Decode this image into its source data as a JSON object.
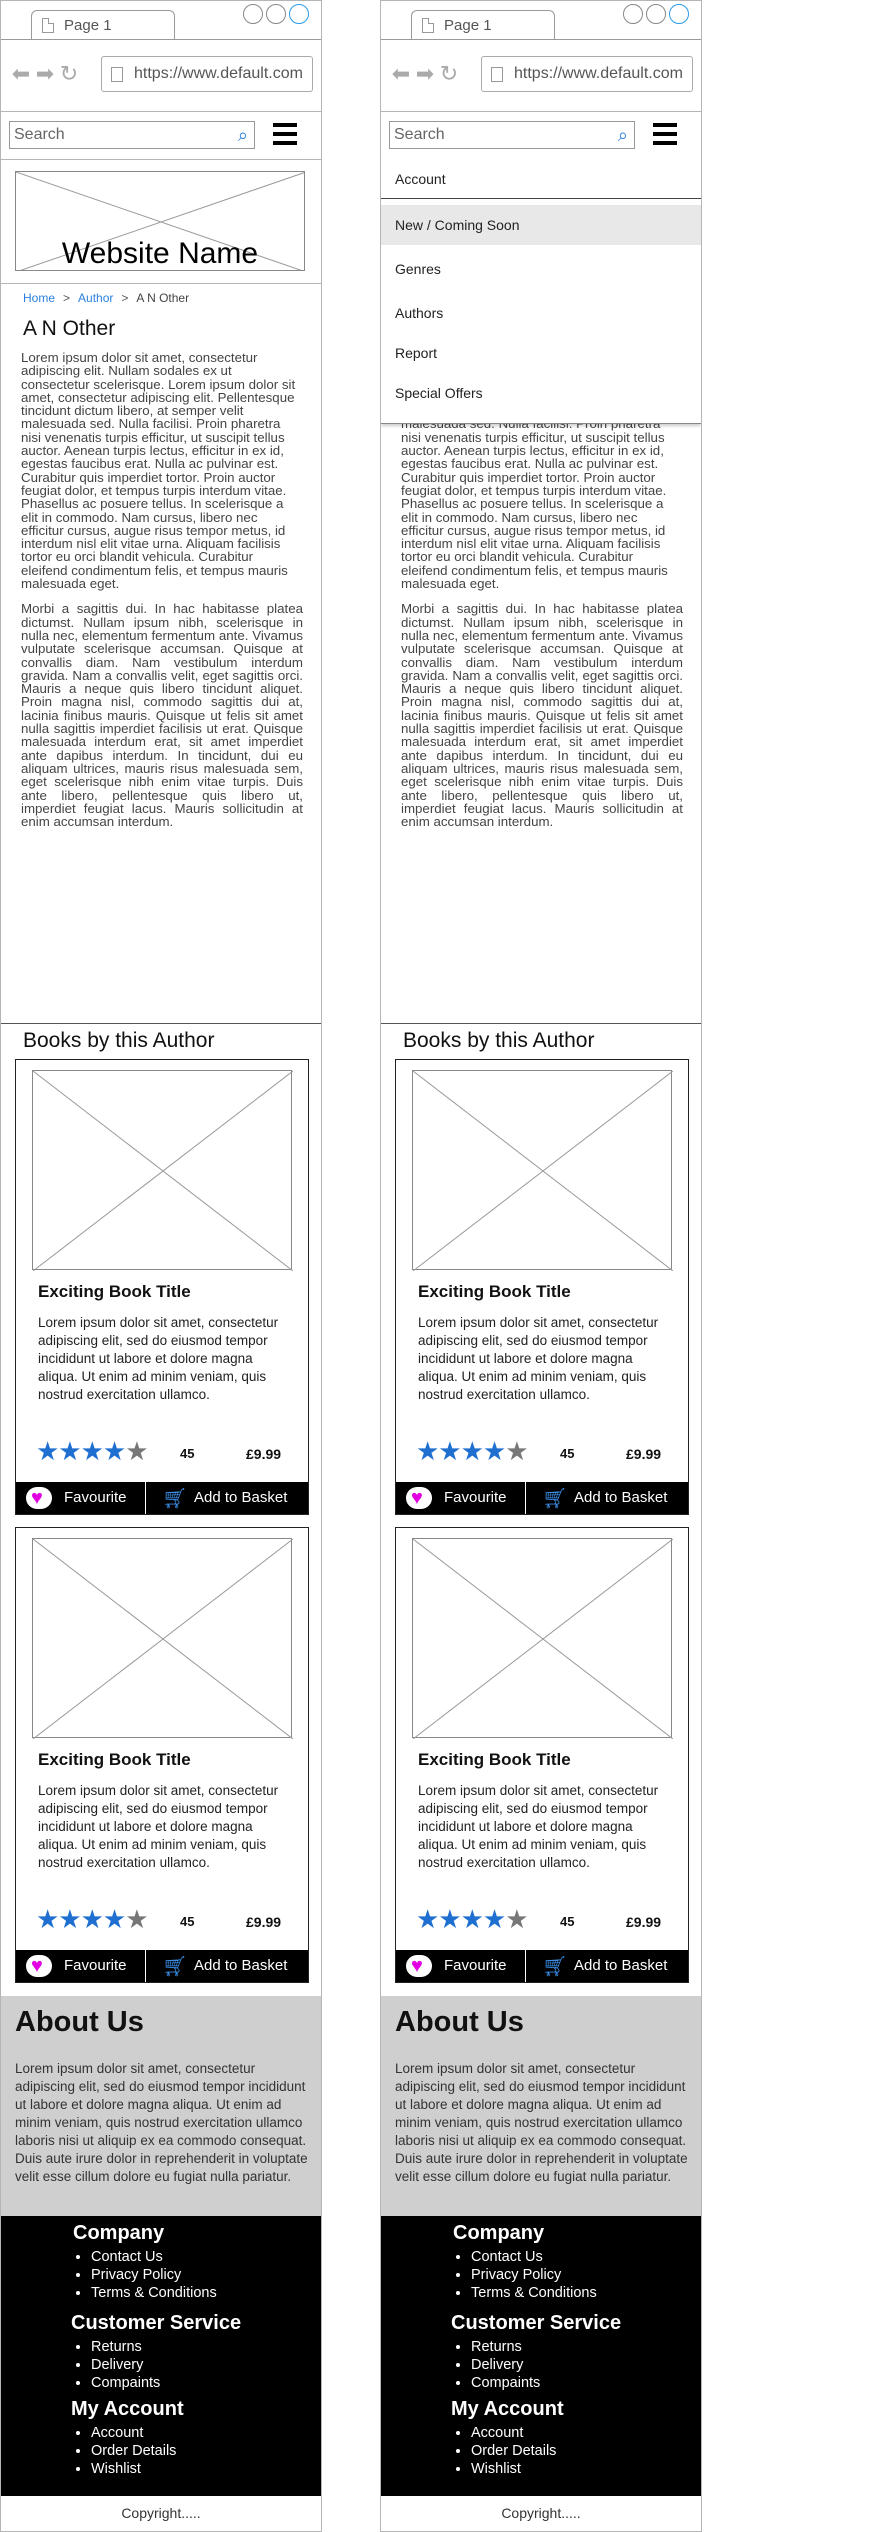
{
  "browser": {
    "tab_label": "Page 1",
    "url": "https://www.default.com"
  },
  "search": {
    "placeholder": "Search"
  },
  "site": {
    "name": "Website Name"
  },
  "breadcrumb": {
    "home": "Home",
    "author": "Author",
    "current": "A N Other",
    "separator": ">"
  },
  "author": {
    "name": "A N Other",
    "bio_p1": "Lorem ipsum dolor sit amet, consectetur adipiscing elit. Nullam sodales ex ut consectetur scelerisque. Lorem ipsum dolor sit amet, consectetur adipiscing elit. Pellentesque tincidunt dictum libero, at semper velit malesuada sed. Nulla facilisi. Proin pharetra nisi venenatis turpis efficitur, ut suscipit tellus auctor. Aenean turpis lectus, efficitur in ex id, egestas faucibus erat. Nulla ac pulvinar est. Curabitur quis imperdiet tortor. Proin auctor feugiat dolor, et tempus turpis interdum vitae. Phasellus ac posuere tellus. In scelerisque a elit in commodo. Nam cursus, libero nec efficitur cursus, augue risus tempor metus, id interdum nisl elit vitae urna. Aliquam facilisis tortor eu orci blandit vehicula. Curabitur eleifend condimentum felis, et tempus mauris malesuada eget.",
    "bio_p2": "Morbi a sagittis dui. In hac habitasse platea dictumst. Nullam ipsum nibh, scelerisque in nulla nec, elementum fermentum ante. Vivamus vulputate scelerisque accumsan. Quisque at convallis diam. Nam vestibulum interdum gravida. Nam a convallis velit, eget sagittis orci. Mauris a neque quis libero tincidunt aliquet. Proin magna nisl, commodo sagittis dui at, lacinia finibus mauris. Quisque ut felis sit amet nulla sagittis imperdiet facilisis ut erat. Quisque malesuada interdum erat, sit amet imperdiet ante dapibus interdum. In tincidunt, dui eu aliquam ultrices, mauris risus malesuada sem, eget scelerisque nibh enim vitae turpis. Duis ante libero, pellentesque quis libero ut, imperdiet feugiat lacus. Mauris sollicitudin at enim accumsan interdum."
  },
  "books_heading": "Books by this Author",
  "books": [
    {
      "title": "Exciting Book Title",
      "description": "Lorem ipsum dolor sit amet, consectetur adipiscing elit, sed do eiusmod tempor incididunt ut labore et dolore magna aliqua. Ut enim ad minim veniam, quis nostrud exercitation ullamco.",
      "rating": 4.5,
      "stars_full": "★★★★",
      "stars_half": "★",
      "rating_count": "45",
      "price": "£9.99",
      "favourite_label": "Favourite",
      "basket_label": "Add to Basket"
    },
    {
      "title": "Exciting Book Title",
      "description": "Lorem ipsum dolor sit amet, consectetur adipiscing elit, sed do eiusmod tempor incididunt ut labore et dolore magna aliqua. Ut enim ad minim veniam, quis nostrud exercitation ullamco.",
      "rating": 4.5,
      "stars_full": "★★★★",
      "stars_half": "★",
      "rating_count": "45",
      "price": "£9.99",
      "favourite_label": "Favourite",
      "basket_label": "Add to Basket"
    }
  ],
  "about": {
    "heading": "About Us",
    "text": "Lorem ipsum dolor sit amet, consectetur adipiscing elit, sed do eiusmod tempor incididunt ut labore et dolore magna aliqua. Ut enim ad minim veniam, quis nostrud exercitation ullamco laboris nisi ut aliquip ex ea commodo consequat. Duis aute irure dolor in reprehenderit in voluptate velit esse cillum dolore eu fugiat nulla pariatur."
  },
  "footer": {
    "company": {
      "heading": "Company",
      "items": [
        "Contact Us",
        "Privacy Policy",
        "Terms & Conditions"
      ]
    },
    "customer_service": {
      "heading": "Customer Service",
      "items": [
        "Returns",
        "Delivery",
        "Compaints"
      ]
    },
    "my_account": {
      "heading": "My Account",
      "items": [
        "Account",
        "Order Details",
        "Wishlist"
      ]
    },
    "copyright": "Copyright....."
  },
  "menu": {
    "items": [
      "Account",
      "New / Coming Soon",
      "Genres",
      "Authors",
      "Report",
      "Special Offers"
    ],
    "active_index": 1
  },
  "colors": {
    "accent_blue": "#1f6fd1",
    "heart_magenta": "#e200e2",
    "footer_bg": "#000000",
    "about_bg": "#cfcfcf"
  }
}
